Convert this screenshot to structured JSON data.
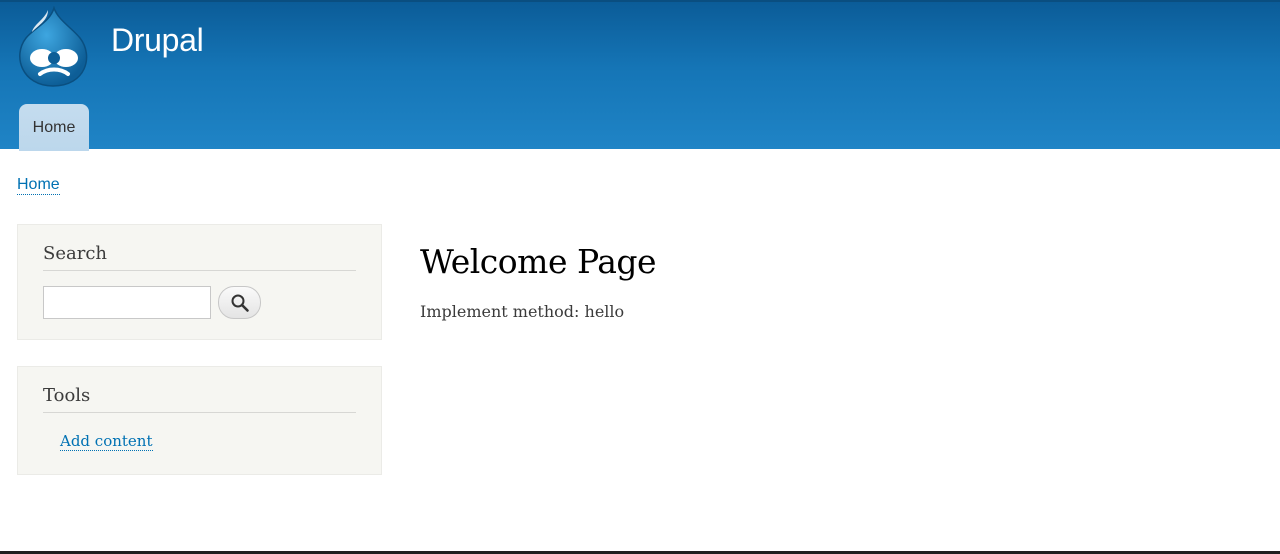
{
  "header": {
    "site_name": "Drupal",
    "logo_icon": "drupal-drop-icon",
    "colors": {
      "gradient_top": "#0b5c98",
      "gradient_bottom": "#1f84c6",
      "tab_bg": "#c4dcee"
    }
  },
  "main_menu": {
    "items": [
      {
        "label": "Home",
        "active": true
      }
    ]
  },
  "breadcrumb": {
    "items": [
      "Home"
    ]
  },
  "sidebar": {
    "search_block": {
      "title": "Search",
      "input_value": "",
      "button_icon": "search-icon"
    },
    "tools_block": {
      "title": "Tools",
      "links": [
        "Add content"
      ]
    }
  },
  "main": {
    "title": "Welcome Page",
    "body": "Implement method: hello"
  },
  "link_color": "#0071b3"
}
